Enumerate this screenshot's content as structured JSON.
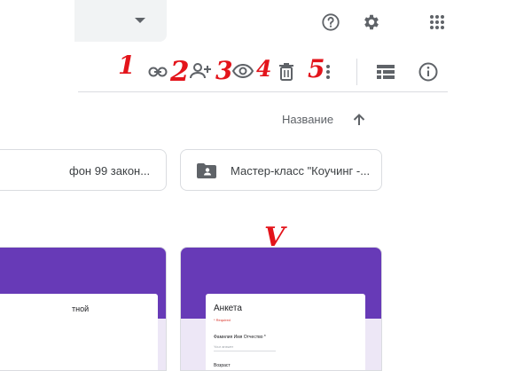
{
  "toolbar": {
    "help_icon": "help-circle-icon",
    "settings_icon": "gear-icon",
    "apps_icon": "apps-grid-icon",
    "actions": [
      {
        "icon": "link-icon"
      },
      {
        "icon": "add-person-icon"
      },
      {
        "icon": "eye-icon"
      },
      {
        "icon": "trash-icon"
      },
      {
        "icon": "more-vert-icon"
      }
    ],
    "view_toggle_icon": "list-view-icon",
    "info_icon": "info-icon"
  },
  "sort": {
    "label": "Название",
    "direction_icon": "arrow-up-icon"
  },
  "folders": [
    {
      "name": "фон 99 закон..."
    },
    {
      "name": "Мастер-класс \"Коучинг -...",
      "icon": "shared-folder-icon"
    }
  ],
  "files": [
    {
      "visible_text": "тной"
    },
    {
      "title": "Анкета",
      "required_note": "* Required",
      "field1_label": "Фамилия Имя Отчество *",
      "field1_placeholder": "Your answer",
      "field2_label": "Возраст"
    }
  ],
  "annotations": {
    "marks": [
      "1",
      "2",
      "3",
      "4",
      "5"
    ],
    "check": "V",
    "color": "#e3141b"
  },
  "colors": {
    "form_header": "#673ab7",
    "form_background": "#ede7f6",
    "divider": "#dadce0"
  }
}
